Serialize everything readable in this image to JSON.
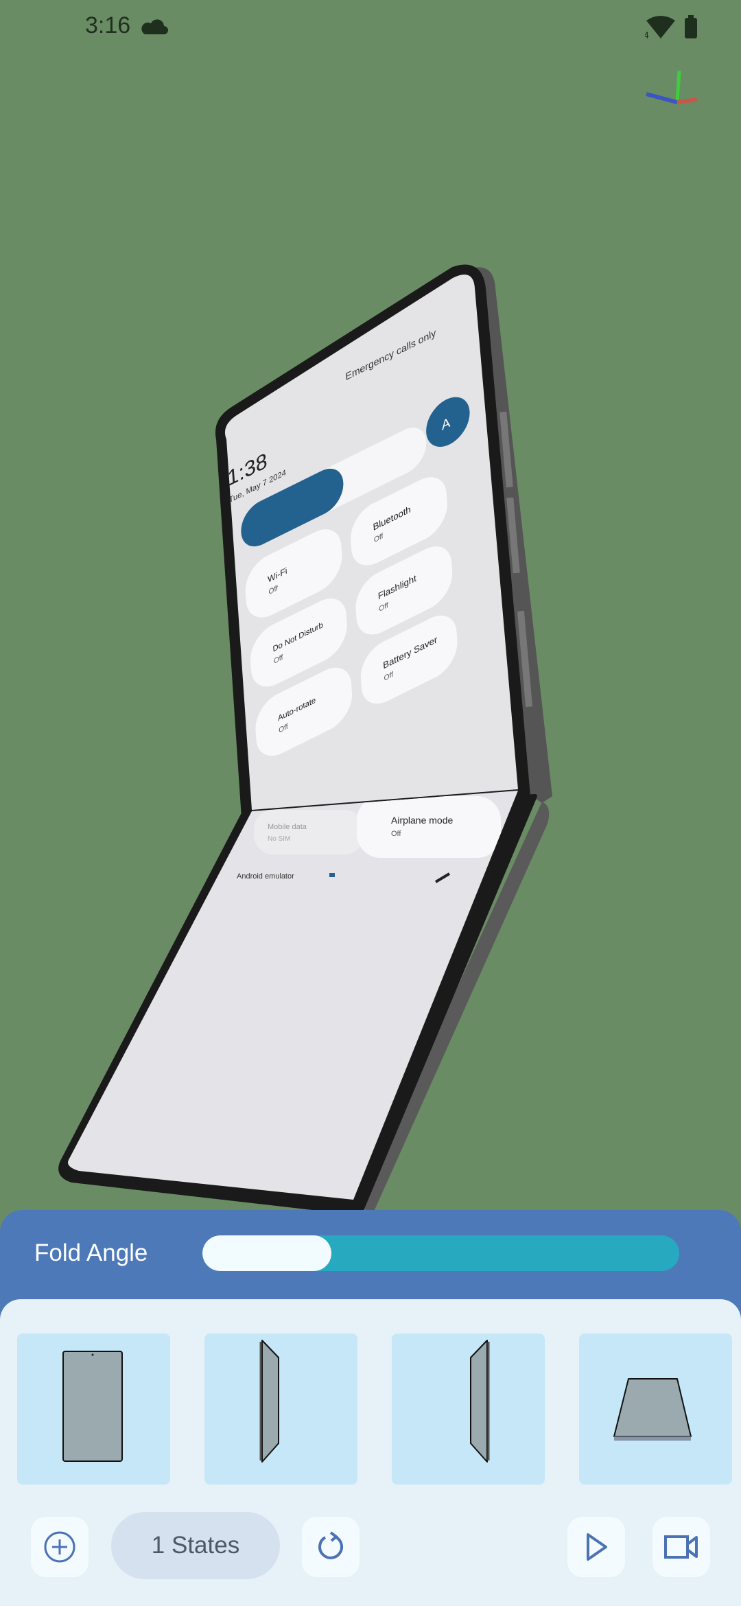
{
  "status_bar": {
    "time": "3:16",
    "icons": [
      "cloud-icon",
      "wifi-icon",
      "battery-icon"
    ],
    "wifi_badge": "4"
  },
  "device_screen": {
    "clock": "1:38",
    "date": "Tue, May 7 2024",
    "carrier": "Emergency calls only",
    "tiles": [
      {
        "label": "Wi-Fi",
        "state": "Off"
      },
      {
        "label": "Bluetooth",
        "state": "Off"
      },
      {
        "label": "Do Not Disturb",
        "state": "Off"
      },
      {
        "label": "Flashlight",
        "state": "Off"
      },
      {
        "label": "Auto-rotate",
        "state": "Off"
      },
      {
        "label": "Battery Saver",
        "state": "Off"
      },
      {
        "label": "Mobile data",
        "state": "No SIM"
      },
      {
        "label": "Airplane mode",
        "state": "Off"
      }
    ],
    "footer": "Android emulator"
  },
  "controls": {
    "fold_angle_label": "Fold Angle",
    "fold_angle_fraction": 0.27,
    "presets": [
      "front-view-preset",
      "left-angle-preset",
      "right-angle-preset",
      "tilted-flat-preset"
    ],
    "states_label": "1 States"
  },
  "colors": {
    "background": "#6a8c64",
    "header": "#4d79b9",
    "slider_track": "#27a9bf",
    "accent": "#4b72b5",
    "tile_blue": "#23618f"
  }
}
